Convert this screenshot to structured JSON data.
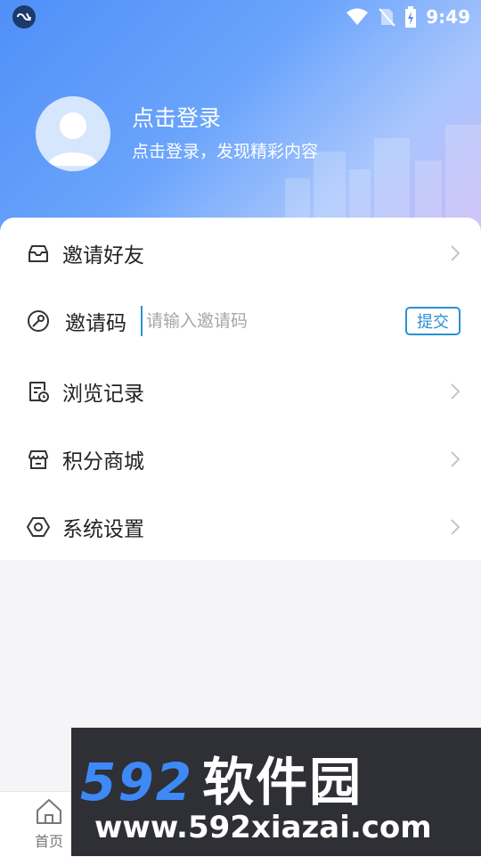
{
  "status_bar": {
    "time": "9:49",
    "icons": [
      "app-badge-icon",
      "wifi-icon",
      "no-sim-icon",
      "battery-charging-icon"
    ]
  },
  "profile": {
    "title": "点击登录",
    "subtitle": "点击登录，发现精彩内容",
    "avatar_icon": "user-avatar-icon"
  },
  "menu": {
    "invite_friends": {
      "label": "邀请好友",
      "icon": "envelope-icon"
    },
    "invite_code": {
      "label": "邀请码",
      "icon": "key-icon",
      "input_value": "",
      "placeholder": "请输入邀请码",
      "submit_label": "提交"
    },
    "history": {
      "label": "浏览记录",
      "icon": "history-doc-icon"
    },
    "points_mall": {
      "label": "积分商城",
      "icon": "store-icon"
    },
    "settings": {
      "label": "系统设置",
      "icon": "hexagon-settings-icon"
    }
  },
  "tabbar": {
    "home_label": "首页",
    "home_icon": "home-icon"
  },
  "watermark": {
    "brand_digits": "592",
    "brand_cn": "软件园",
    "url": "www.592xiazai.com"
  },
  "colors": {
    "header_gradient_start": "#4f8ff7",
    "header_gradient_end": "#c8b8f7",
    "accent": "#2b8fd6",
    "text_primary": "#222222",
    "placeholder": "#a6a6a6"
  }
}
